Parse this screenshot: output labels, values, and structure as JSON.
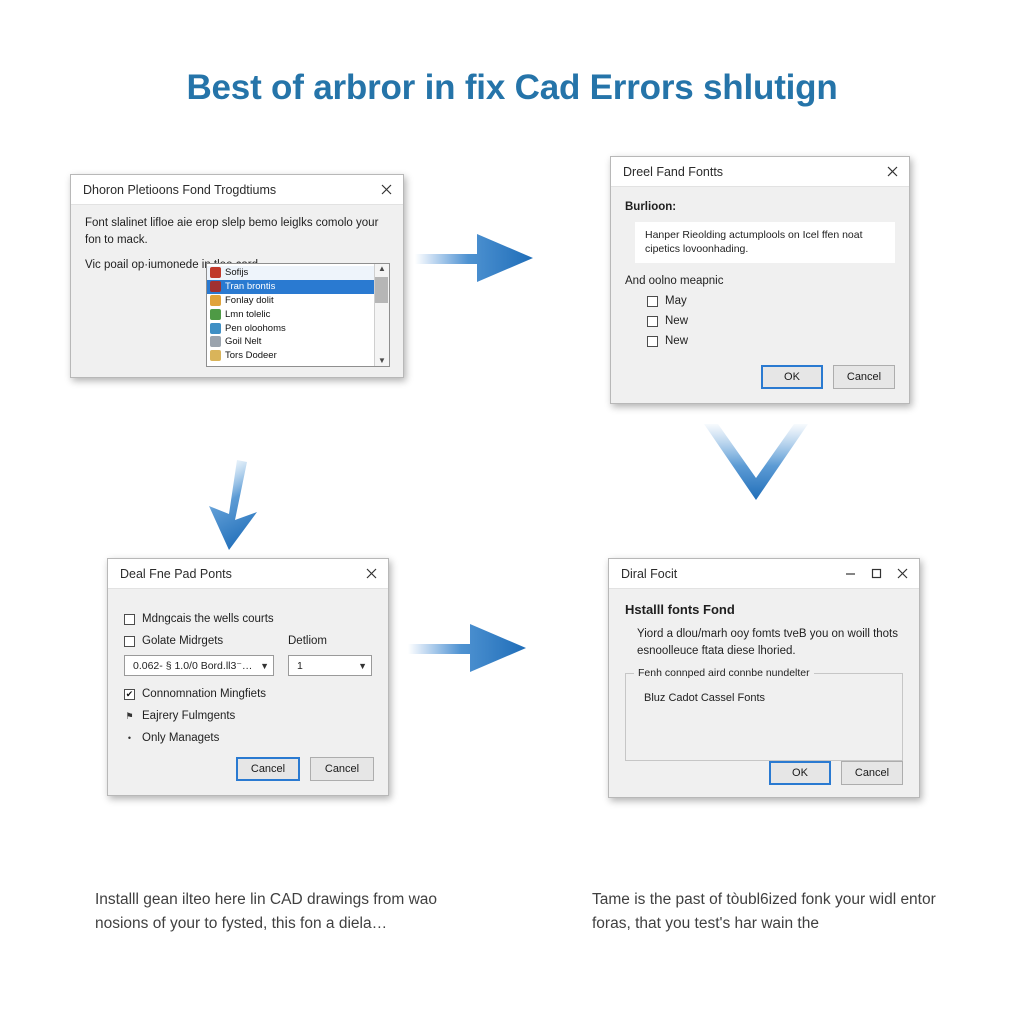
{
  "page": {
    "title": "Best of arbror in fix Cad Errors shlutign",
    "title_color": "#2574a9",
    "background": "#ffffff",
    "accent_color": "#2a7ad1"
  },
  "dialog1": {
    "title": "Dhoron Pletioons Fond Trogdtiums",
    "close_icon": "close-icon",
    "paragraphs": [
      "Font slalinet lifloe aie erop slelp bemo leiglks comolo your fon to mack.",
      "Vic poail op·iumonede in tlee card."
    ],
    "list": {
      "items": [
        {
          "label": "Sofijs",
          "icon_color": "#c0392b",
          "state": "normal"
        },
        {
          "label": "Tran brontis",
          "icon_color": "#a03030",
          "state": "selected"
        },
        {
          "label": "Fonlay dolit",
          "icon_color": "#e0a33a",
          "state": "normal"
        },
        {
          "label": "Lmn tolelic",
          "icon_color": "#4e9a45",
          "state": "normal"
        },
        {
          "label": "Pen oloohoms",
          "icon_color": "#3f8fc4",
          "state": "normal"
        },
        {
          "label": "Goil Nelt",
          "icon_color": "#9aa3ad",
          "state": "normal"
        },
        {
          "label": "Tors Dodeer",
          "icon_color": "#d9b45a",
          "state": "normal"
        }
      ],
      "scroll_up_icon": "chevron-up-icon",
      "scroll_down_icon": "chevron-down-icon"
    }
  },
  "dialog2": {
    "title": "Dreel Fand Fontts",
    "close_icon": "close-icon",
    "heading": "Burlioon:",
    "field_text": "Hanper Rieolding actumplools on Icel ffen noat cipetics lovoonhading.",
    "group_label": "And oolno meapnic",
    "checkboxes": [
      {
        "label": "May",
        "checked": false
      },
      {
        "label": "New",
        "checked": false
      },
      {
        "label": "New",
        "checked": false
      }
    ],
    "buttons": [
      {
        "label": "OK",
        "default": true
      },
      {
        "label": "Cancel",
        "default": false
      }
    ]
  },
  "dialog3": {
    "title": "Deal Fne Pad Ponts",
    "close_icon": "close-icon",
    "checkbox_top": {
      "label": "Mdngcais the wells courts",
      "checked": false
    },
    "checkbox_mid": {
      "label": "Golate Midrgets",
      "checked": false
    },
    "dropdown_right_label": "Detliom",
    "combo_left_value": "0.062- § 1.0/0 Bord.ll3⁻…",
    "combo_right_value": "1",
    "chevron_icon": "chevron-down-icon",
    "checkbox_checked": {
      "label": "Connomnation Mingfiets",
      "checked": true
    },
    "bullets": [
      {
        "label": "Eajrery Fulmgents",
        "icon": "flag-icon"
      },
      {
        "label": "Only Managets",
        "icon": "dot-icon"
      }
    ],
    "buttons": [
      {
        "label": "Cancel",
        "default": true
      },
      {
        "label": "Cancel",
        "default": false
      }
    ]
  },
  "dialog4": {
    "title": "Diral Focit",
    "minimize_icon": "minimize-icon",
    "maximize_icon": "maximize-icon",
    "close_icon": "close-icon",
    "heading": "Hstalll fonts Fond",
    "subtext": "Yiord a dlou/marh ooy fomts tveB you on woill thots esnoolleuce ftata diese lhoried.",
    "group_label": "Fenh connped aird connbe nundelter",
    "group_content": "Bluz Cadot Cassel Fonts",
    "buttons": [
      {
        "label": "OK",
        "default": true
      },
      {
        "label": "Cancel",
        "default": false
      }
    ]
  },
  "arrows": [
    {
      "name": "arrow-right-top",
      "direction": "right"
    },
    {
      "name": "arrow-chevron-down-right",
      "direction": "down"
    },
    {
      "name": "arrow-down-left",
      "direction": "down"
    },
    {
      "name": "arrow-right-bottom",
      "direction": "right"
    }
  ],
  "captions": {
    "left": "Installl gean ilteo here lin CAD drawings from wao nosions of your to fysted, this fon a diela…",
    "right": "Tame is the past of tòubl6ized fonk your widl entor foras, that you test's har wain the"
  }
}
